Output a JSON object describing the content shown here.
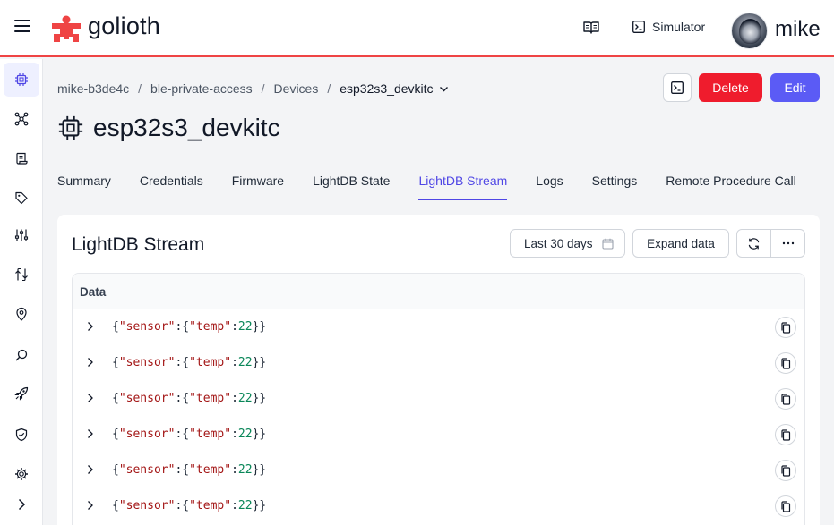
{
  "header": {
    "logo_text": "golioth",
    "simulator_label": "Simulator",
    "username": "mike",
    "colors": {
      "brand_red": "#ef4444",
      "primary": "#5b5bf5",
      "danger": "#ef1c2d"
    }
  },
  "sidebar": {
    "items": [
      {
        "icon": "chip-icon",
        "active": true
      },
      {
        "icon": "nodes-icon"
      },
      {
        "icon": "scroll-icon"
      },
      {
        "icon": "tag-icon"
      },
      {
        "icon": "sliders-icon"
      },
      {
        "icon": "pipeline-icon"
      },
      {
        "icon": "location-icon"
      },
      {
        "icon": "search-icon"
      },
      {
        "icon": "rocket-icon"
      },
      {
        "icon": "shield-icon"
      },
      {
        "icon": "gear-icon"
      },
      {
        "icon": "chevron-right-icon"
      }
    ]
  },
  "breadcrumb": {
    "items": [
      "mike-b3de4c",
      "ble-private-access",
      "Devices"
    ],
    "current": "esp32s3_devkitc"
  },
  "actions": {
    "delete_label": "Delete",
    "edit_label": "Edit"
  },
  "page": {
    "title": "esp32s3_devkitc"
  },
  "tabs": [
    {
      "label": "Summary"
    },
    {
      "label": "Credentials"
    },
    {
      "label": "Firmware"
    },
    {
      "label": "LightDB State"
    },
    {
      "label": "LightDB Stream",
      "active": true
    },
    {
      "label": "Logs"
    },
    {
      "label": "Settings"
    },
    {
      "label": "Remote Procedure Call"
    }
  ],
  "stream": {
    "title": "LightDB Stream",
    "range_label": "Last 30 days",
    "expand_label": "Expand data",
    "column_header": "Data",
    "rows": [
      {
        "key": "sensor",
        "subkey": "temp",
        "value": "22"
      },
      {
        "key": "sensor",
        "subkey": "temp",
        "value": "22"
      },
      {
        "key": "sensor",
        "subkey": "temp",
        "value": "22"
      },
      {
        "key": "sensor",
        "subkey": "temp",
        "value": "22"
      },
      {
        "key": "sensor",
        "subkey": "temp",
        "value": "22"
      },
      {
        "key": "sensor",
        "subkey": "temp",
        "value": "22"
      }
    ]
  }
}
